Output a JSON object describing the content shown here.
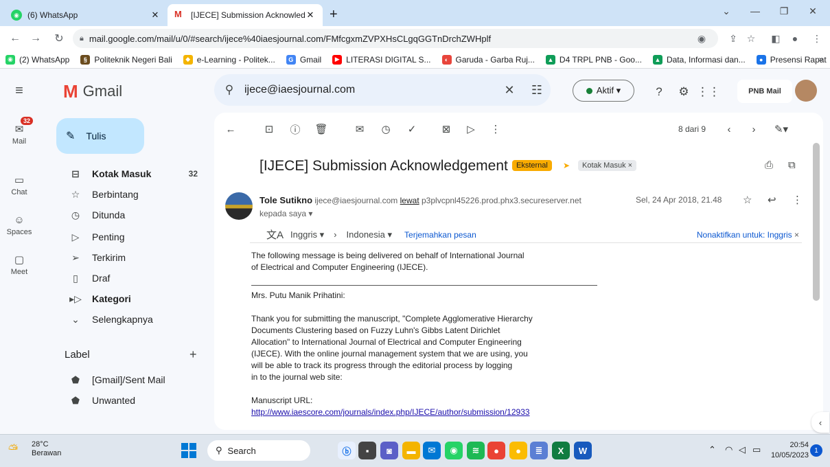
{
  "browser": {
    "tabs": [
      {
        "title": "(6) WhatsApp",
        "close": "✕"
      },
      {
        "title": "[IJECE] Submission Acknowledge",
        "close": "✕"
      }
    ],
    "new_tab": "+",
    "url": "mail.google.com/mail/u/0/#search/ijece%40iaesjournal.com/FMfcgxmZVPXHsCLgqGGTnDrchZWHplf",
    "bookmarks": [
      {
        "label": "(2) WhatsApp",
        "color": "#25d366",
        "glyph": "◉"
      },
      {
        "label": "Politeknik Negeri Bali",
        "color": "#6b4c1e",
        "glyph": "§"
      },
      {
        "label": "e-Learning - Politek...",
        "color": "#f4b400",
        "glyph": "◆"
      },
      {
        "label": "Gmail",
        "color": "#4285f4",
        "glyph": "G"
      },
      {
        "label": "LITERASI DIGITAL S...",
        "color": "#ff0000",
        "glyph": "▶"
      },
      {
        "label": "Garuda - Garba Ruj...",
        "color": "#e8453c",
        "glyph": "◐"
      },
      {
        "label": "D4 TRPL PNB - Goo...",
        "color": "#0f9d58",
        "glyph": "▲"
      },
      {
        "label": "Data, Informasi dan...",
        "color": "#0f9d58",
        "glyph": "▲"
      },
      {
        "label": "Presensi Rapat",
        "color": "#1a73e8",
        "glyph": "●"
      }
    ],
    "bookmarks_more": "»"
  },
  "gmail": {
    "logo_word": "Gmail",
    "search": {
      "value": "ijece@iaesjournal.com"
    },
    "status": "Aktif ▾",
    "org_logo": "PNB Mail",
    "rail": [
      {
        "label": "Mail",
        "badge": "32",
        "icon": "mail-icon"
      },
      {
        "label": "Chat",
        "icon": "chat-icon"
      },
      {
        "label": "Spaces",
        "icon": "spaces-icon"
      },
      {
        "label": "Meet",
        "icon": "meet-icon"
      }
    ],
    "compose": "Tulis",
    "nav": [
      {
        "label": "Kotak Masuk",
        "count": "32",
        "icon": "inbox-icon"
      },
      {
        "label": "Berbintang",
        "icon": "star-icon"
      },
      {
        "label": "Ditunda",
        "icon": "clock-icon"
      },
      {
        "label": "Penting",
        "icon": "important-icon"
      },
      {
        "label": "Terkirim",
        "icon": "send-icon"
      },
      {
        "label": "Draf",
        "icon": "draft-icon"
      },
      {
        "label": "Kategori",
        "icon": "label-icon"
      },
      {
        "label": "Selengkapnya",
        "icon": "chevron-down-icon"
      }
    ],
    "label_heading": "Label",
    "labels": [
      "[Gmail]/Sent Mail",
      "Unwanted"
    ]
  },
  "message": {
    "page_indicator": "8 dari 9",
    "subject": "[IJECE] Submission Acknowledgement",
    "chip_external": "Eksternal",
    "chip_inbox": "Kotak Masuk ×",
    "sender_name": "Tole Sutikno",
    "sender_email": "ijece@iaesjournal.com",
    "via_word": "lewat",
    "via_server": "p3plvcpnl45226.prod.phx3.secureserver.net",
    "to": "kepada saya ▾",
    "date": "Sel, 24 Apr 2018, 21.48",
    "translate": {
      "from": "Inggris ▾",
      "arrow": "›",
      "to": "Indonesia ▾",
      "action": "Terjemahkan pesan",
      "disable": "Nonaktifkan untuk: Inggris"
    },
    "body": {
      "intro": "The following message is being delivered on behalf of International Journal\nof Electrical and Computer Engineering (IJECE).",
      "salutation": "Mrs. Putu Manik Prihatini:",
      "para1": "Thank you for submitting the manuscript, \"Complete Agglomerative Hierarchy\nDocuments Clustering based on Fuzzy Luhn's Gibbs Latent Dirichlet\nAllocation\" to International Journal of Electrical and Computer Engineering\n(IJECE). With the online journal management system that we are using, you\nwill be able to track its progress through the editorial process by logging\nin to the journal web site:",
      "url_label": "Manuscript URL:",
      "url": "http://www.iaescore.com/journals/index.php/IJECE/author/submission/12933"
    }
  },
  "taskbar": {
    "temp": "28°C",
    "weather": "Berawan",
    "search": "Search",
    "time": "20:54",
    "date": "10/05/2023",
    "notif_count": "1"
  }
}
